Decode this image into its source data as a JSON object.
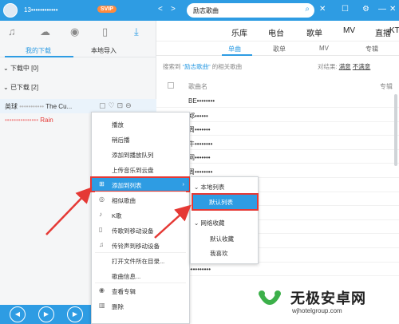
{
  "topbar": {
    "username": "13••••••••••••",
    "badge": "SVIP",
    "search_value": "励志歌曲",
    "back_glyph": "<",
    "forward_glyph": ">",
    "search_glyph": "⌕",
    "close_glyph": "✕"
  },
  "left": {
    "tabs": [
      "我的下载",
      "本地导入"
    ],
    "groups": [
      {
        "label": "下载中",
        "count": "[0]"
      },
      {
        "label": "已下载",
        "count": "[2]"
      }
    ],
    "tracks": [
      {
        "prefix": "英球",
        "name": "•••••••••••",
        "suffix": "The Cu..."
      },
      {
        "prefix": "",
        "name": "•••••••••••••••",
        "suffix": "Rain"
      }
    ]
  },
  "nav": {
    "items": [
      "乐库",
      "电台",
      "歌单",
      "MV",
      "直播",
      "KT"
    ]
  },
  "search_tabs": {
    "items": [
      "单曲",
      "歌单",
      "MV",
      "专辑"
    ]
  },
  "results": {
    "info_prefix": "搜索到",
    "keyword": "“励志歌曲”",
    "info_suffix": "的相关歌曲",
    "compare_label": "对结果:",
    "compare_a": "满意",
    "compare_b": "不满意",
    "col_name": "歌曲名",
    "col_album": "专辑",
    "rows": [
      "BE••••••••",
      "郑••••••",
      "周•••••••",
      "牛••••••••",
      "网•••••••",
      "周••••••••",
      "周•••••",
      "万••••••••",
      "S••••••",
      "S•••••••••",
      "•••••••••",
      "••••••••",
      "••••••••••"
    ]
  },
  "context_menu": {
    "items": [
      {
        "label": "播放",
        "icon": ""
      },
      {
        "label": "稍后播",
        "icon": ""
      },
      {
        "label": "添加到播放队列",
        "icon": ""
      },
      {
        "label": "上传音乐到云盘",
        "icon": ""
      },
      {
        "label": "添加到列表",
        "icon": "⊞"
      },
      {
        "label": "相似歌曲",
        "icon": "◎"
      },
      {
        "label": "K歌",
        "icon": "♪"
      },
      {
        "label": "传歌到移动设备",
        "icon": "▯"
      },
      {
        "label": "传铃声到移动设备",
        "icon": "♫"
      },
      {
        "label": "打开文件所在目录...",
        "icon": ""
      },
      {
        "label": "歌曲信息...",
        "icon": ""
      },
      {
        "label": "查看专辑",
        "icon": "◉"
      },
      {
        "label": "删除",
        "icon": "▥"
      }
    ],
    "arrow": "›"
  },
  "submenu": {
    "local_header": "本地列表",
    "default_list": "默认列表",
    "cloud_header": "网络收藏",
    "default_fav": "默认收藏",
    "liked": "我喜欢"
  },
  "watermark": {
    "title": "无极安卓网",
    "url": "wjhotelgroup.com"
  },
  "colors": {
    "accent": "#2e9ce3",
    "highlight_border": "#e53935",
    "watermark_green": "#3cb04a"
  }
}
